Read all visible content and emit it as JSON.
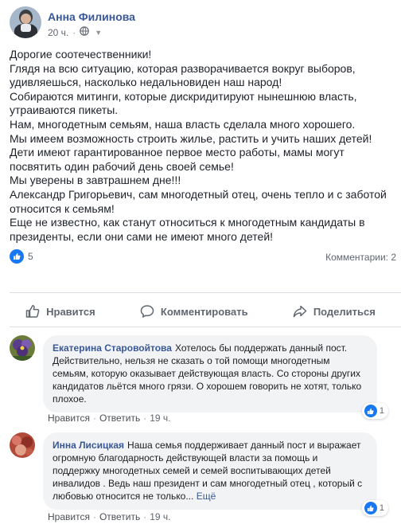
{
  "post": {
    "author": "Анна Филинова",
    "time": "20 ч.",
    "paragraphs": [
      "Дорогие соотечественники!",
      "Глядя на всю ситуацию, которая разворачивается вокруг выборов, удивляешься, насколько недальновиден наш народ!",
      "Собираются митинги, которые дискридитируют нынешнюю власть, утраиваются пикеты.",
      "Нам, многодетным семьям, наша власть сделала много хорошего.",
      "Мы имеем возможность строить жилье, растить и учить наших детей!",
      "Дети имеют гарантированное первое место работы, мамы могут посвятить один рабочий день своей семье!",
      "Мы уверены в завтрашнем дне!!!",
      "Александр Григорьевич, сам многодетный отец, очень тепло и с заботой относится к семьям!",
      "Еще не известно, как станут относиться к многодетным кандидаты в президенты, если они сами не имеют много детей!"
    ],
    "reaction_count": "5",
    "comments_count": "Комментарии: 2"
  },
  "actions": {
    "like": "Нравится",
    "comment": "Комментировать",
    "share": "Поделиться"
  },
  "comments": [
    {
      "author": "Екатерина Старовойтова",
      "text": "Хотелось бы поддержать данный пост. Действительно, нельзя не сказать о той помощи многодетным семьям, которую оказывает действующая власть. Со стороны других кандидатов льётся много грязи. О хорошем говорить не хотят, только плохое.",
      "more": "",
      "likes": "1",
      "like_label": "Нравится",
      "reply_label": "Ответить",
      "time": "19 ч."
    },
    {
      "author": "Инна Лисицкая",
      "text": "Наша семья поддерживает данный пост и выражает огромную благодарность действующей власти за помощь и поддержку многодетных семей и семей воспитывающих детей инвалидов . Ведь наш президент и сам многодетный отец , который с любовью относится не только...",
      "more": "Ещё",
      "likes": "1",
      "like_label": "Нравится",
      "reply_label": "Ответить",
      "time": "19 ч."
    }
  ],
  "icons": {
    "privacy": "globe-icon",
    "options": "chevron-down-icon",
    "reaction": "thumbs-up-icon",
    "like_action": "thumbs-up-outline-icon",
    "comment_action": "speech-bubble-icon",
    "share_action": "share-arrow-icon"
  },
  "colors": {
    "name_link": "#385898",
    "like_blue": "#1877f2",
    "secondary_text": "#616770",
    "comment_bubble": "#f2f3f5"
  }
}
